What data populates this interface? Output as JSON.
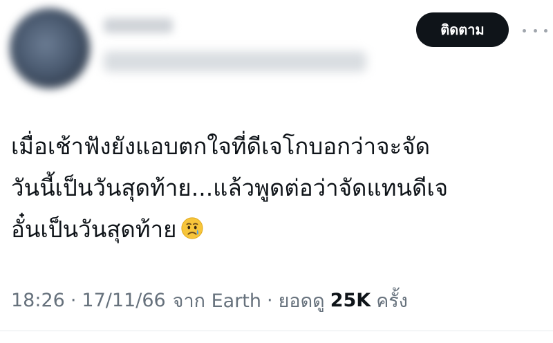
{
  "header": {
    "follow_label": "ติดตาม",
    "more_icon": "more-horizontal-icon"
  },
  "tweet": {
    "lines": [
      "เมื่อเช้าฟังยังแอบตกใจที่ดีเจโกบอกว่าจะจัด",
      "วันนี้เป็นวันสุดท้าย...แล้วพูดต่อว่าจัดแทนดีเจ",
      "อั๋นเป็นวันสุดท้าย"
    ],
    "emoji": "crying-face-icon"
  },
  "meta": {
    "time": "18:26",
    "sep1": "·",
    "date": "17/11/66",
    "source": "จาก Earth",
    "sep2": "·",
    "views_prefix": "ยอดดู",
    "views_count": "25K",
    "views_suffix": "ครั้ง"
  },
  "colors": {
    "text": "#0f1419",
    "muted": "#66717c",
    "button_bg": "#0f1419",
    "button_text": "#ffffff"
  }
}
